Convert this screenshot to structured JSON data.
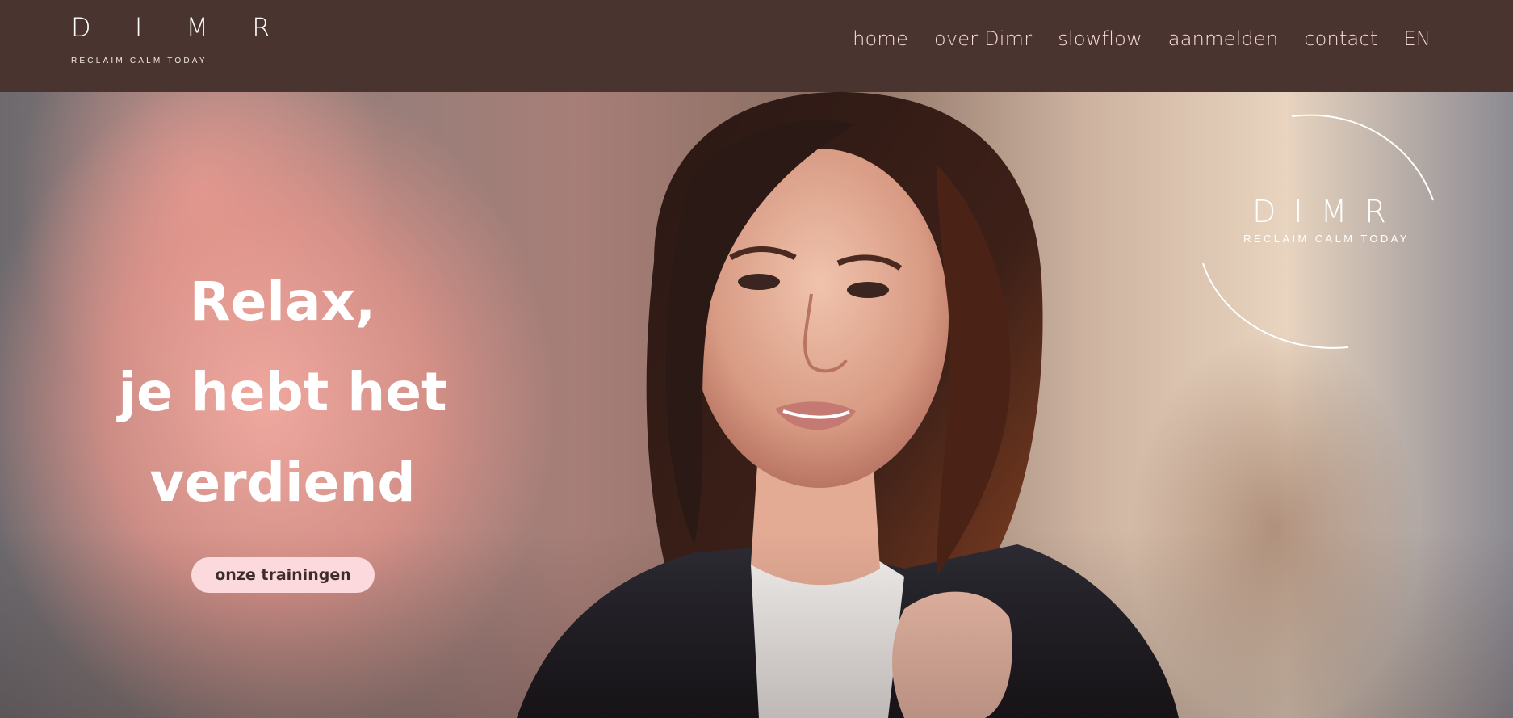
{
  "brand": {
    "name": "D I M R",
    "tagline": "RECLAIM CALM TODAY"
  },
  "nav": {
    "items": [
      {
        "label": "home"
      },
      {
        "label": "over Dimr"
      },
      {
        "label": "slowflow"
      },
      {
        "label": "aanmelden"
      },
      {
        "label": "contact"
      },
      {
        "label": "EN"
      }
    ]
  },
  "hero": {
    "headline_line1": "Relax,",
    "headline_line2": "je hebt het",
    "headline_line3": "verdiend",
    "cta_label": "onze trainingen",
    "badge_name": "DIMR",
    "badge_tagline": "RECLAIM CALM TODAY",
    "photo_subject": "smiling woman with long dark hair in black jacket"
  },
  "colors": {
    "header_bg": "#4a342f",
    "nav_text": "#f7d9d6",
    "cta_bg": "#fbd9dc",
    "hero_text": "#ffffff"
  }
}
